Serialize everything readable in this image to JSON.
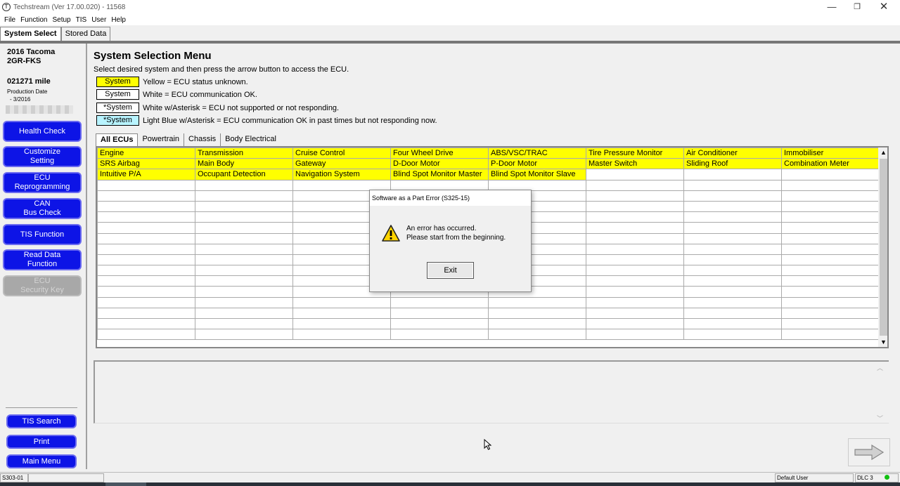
{
  "window": {
    "title": "Techstream (Ver 17.00.020) - 11568",
    "icon_glyph": "T",
    "minimize_glyph": "—",
    "maximize_glyph": "❐",
    "close_glyph": "✕"
  },
  "menubar": [
    "File",
    "Function",
    "Setup",
    "TIS",
    "User",
    "Help"
  ],
  "main_tabs": [
    "System Select",
    "Stored Data"
  ],
  "sidebar": {
    "vehicle_model": "2016 Tacoma",
    "vehicle_engine": "2GR-FKS",
    "mileage": "021271 mile",
    "production_label": "Production Date",
    "production_date": "- 3/2016",
    "buttons": [
      [
        "Health Check"
      ],
      [
        "Customize",
        "Setting"
      ],
      [
        "ECU",
        "Reprogramming"
      ],
      [
        "CAN",
        "Bus Check"
      ],
      [
        "TIS Function"
      ],
      [
        "Read Data",
        "Function"
      ],
      [
        "ECU",
        "Security Key"
      ]
    ],
    "bottom_buttons": [
      "TIS Search",
      "Print",
      "Main Menu"
    ]
  },
  "main": {
    "title": "System Selection Menu",
    "instruction": "Select desired system and then press the arrow button to access the ECU.",
    "legend": [
      {
        "box": "System",
        "text": "Yellow = ECU status unknown.",
        "color": "#ffff00"
      },
      {
        "box": "System",
        "text": "White = ECU communication OK.",
        "color": "#ffffff"
      },
      {
        "box": "*System",
        "text": "White w/Asterisk = ECU not supported or not responding.",
        "color": "#ffffff"
      },
      {
        "box": "*System",
        "text": "Light Blue w/Asterisk = ECU communication OK in past times but not responding now.",
        "color": "#b8f4ff"
      }
    ],
    "sub_tabs": [
      "All ECUs",
      "Powertrain",
      "Chassis",
      "Body Electrical"
    ],
    "ecu_rows": [
      [
        "Engine",
        "Transmission",
        "Cruise Control",
        "Four Wheel Drive",
        "ABS/VSC/TRAC",
        "Tire Pressure Monitor",
        "Air Conditioner",
        "Immobiliser"
      ],
      [
        "SRS Airbag",
        "Main Body",
        "Gateway",
        "D-Door Motor",
        "P-Door Motor",
        "Master Switch",
        "Sliding Roof",
        "Combination Meter"
      ],
      [
        "Intuitive P/A",
        "Occupant Detection",
        "Navigation System",
        "Blind Spot Monitor Master",
        "Blind Spot Monitor Slave",
        "",
        "",
        ""
      ]
    ],
    "empty_rows": 15
  },
  "dialog": {
    "title": "Software as a Part Error (S325-15)",
    "line1": "An error has occurred.",
    "line2": "Please start from the beginning.",
    "exit_label": "Exit"
  },
  "statusbar": {
    "code": "S303-01",
    "user": "Default User",
    "connection": "DLC 3"
  },
  "scroll": {
    "up": "▲",
    "down": "▼",
    "msg_up": "︿",
    "msg_down": "﹀"
  }
}
